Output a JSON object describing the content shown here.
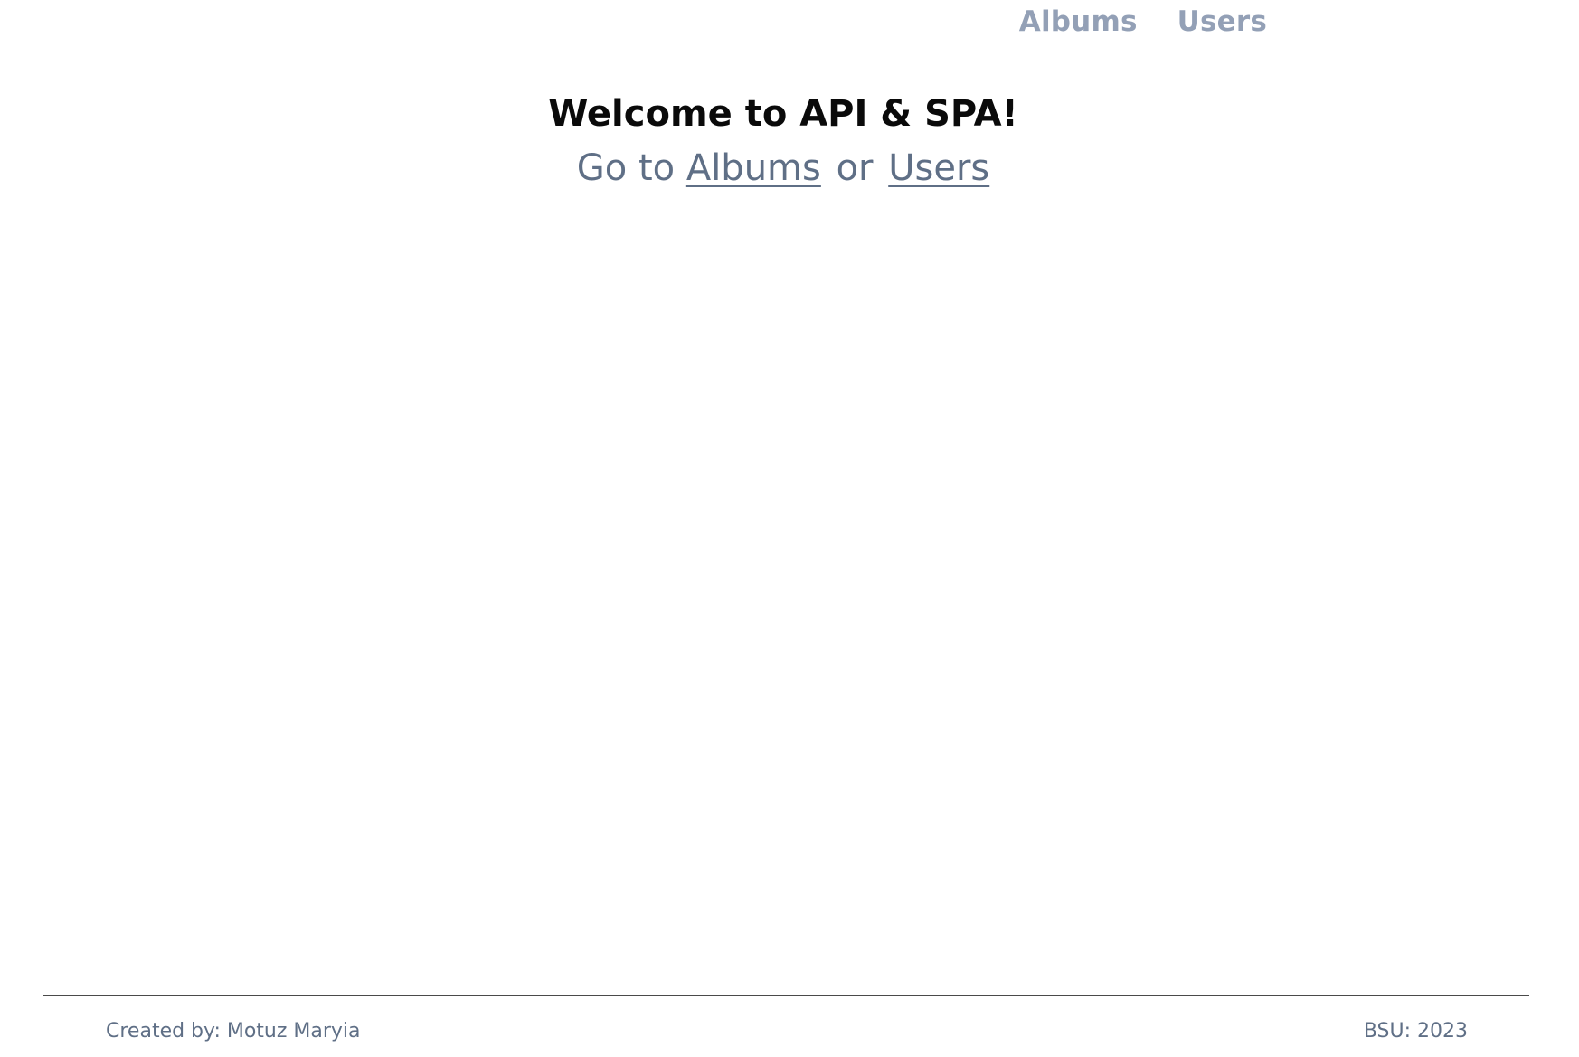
{
  "nav": {
    "albums_label": "Albums",
    "users_label": "Users"
  },
  "hero": {
    "title": "Welcome to API & SPA!",
    "goto_prefix": "Go to",
    "albums_link": "Albums",
    "separator": "or",
    "users_link": "Users"
  },
  "footer": {
    "created_by": "Created by: Motuz Maryia",
    "org_year": "BSU: 2023"
  },
  "colors": {
    "nav_link": "#93a0b6",
    "text_muted": "#5f6f86",
    "title": "#0a0a0a"
  }
}
